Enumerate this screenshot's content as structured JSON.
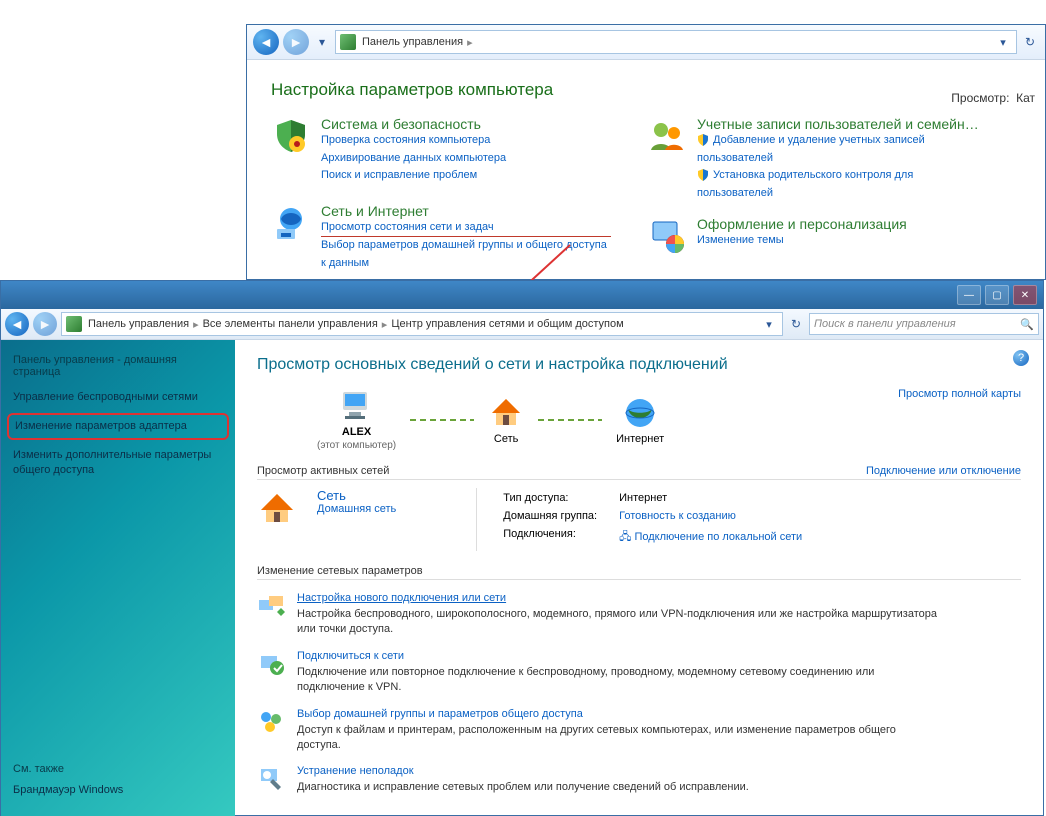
{
  "win1": {
    "breadcrumb_root": "Панель управления",
    "title": "Настройка параметров компьютера",
    "view_label": "Просмотр:",
    "view_value": "Кат",
    "cats": [
      {
        "title": "Система и безопасность",
        "links": [
          "Проверка состояния компьютера",
          "Архивирование данных компьютера",
          "Поиск и исправление проблем"
        ]
      },
      {
        "title": "Сеть и Интернет",
        "links": [
          "Просмотр состояния сети и задач",
          "Выбор параметров домашней группы и общего доступа к данным"
        ]
      },
      {
        "title": "Учетные записи пользователей и семейн…",
        "links": [
          "Добавление и удаление учетных записей пользователей",
          "Установка родительского контроля для пользователей"
        ]
      },
      {
        "title": "Оформление и персонализация",
        "links": [
          "Изменение темы"
        ]
      }
    ]
  },
  "win2": {
    "breadcrumb": [
      "Панель управления",
      "Все элементы панели управления",
      "Центр управления сетями и общим доступом"
    ],
    "search_placeholder": "Поиск в панели управления",
    "sidebar": {
      "header": "Панель управления - домашняя страница",
      "items": [
        "Управление беспроводными сетями",
        "Изменение параметров адаптера",
        "Изменить дополнительные параметры общего доступа"
      ],
      "see_also_label": "См. также",
      "see_also": [
        "Брандмауэр Windows"
      ]
    },
    "main": {
      "title": "Просмотр основных сведений о сети и настройка подключений",
      "full_map": "Просмотр полной карты",
      "nodes": [
        {
          "name": "ALEX",
          "sub": "(этот компьютер)"
        },
        {
          "name": "Сеть",
          "sub": ""
        },
        {
          "name": "Интернет",
          "sub": ""
        }
      ],
      "section_active": "Просмотр активных сетей",
      "connect_disconnect": "Подключение или отключение",
      "network_name": "Сеть",
      "network_type": "Домашняя сеть",
      "props": [
        {
          "label": "Тип доступа:",
          "value": "Интернет",
          "link": false
        },
        {
          "label": "Домашняя группа:",
          "value": "Готовность к созданию",
          "link": true
        },
        {
          "label": "Подключения:",
          "value": "Подключение по локальной сети",
          "link": true
        }
      ],
      "section_change": "Изменение сетевых параметров",
      "tasks": [
        {
          "title": "Настройка нового подключения или сети",
          "desc": "Настройка беспроводного, широкополосного, модемного, прямого или VPN-подключения или же настройка маршрутизатора или точки доступа.",
          "und": true
        },
        {
          "title": "Подключиться к сети",
          "desc": "Подключение или повторное подключение к беспроводному, проводному, модемному сетевому соединению или подключение к VPN.",
          "und": false
        },
        {
          "title": "Выбор домашней группы и параметров общего доступа",
          "desc": "Доступ к файлам и принтерам, расположенным на других сетевых компьютерах, или изменение параметров общего доступа.",
          "und": false
        },
        {
          "title": "Устранение неполадок",
          "desc": "Диагностика и исправление сетевых проблем или получение сведений об исправлении.",
          "und": false
        }
      ]
    }
  }
}
